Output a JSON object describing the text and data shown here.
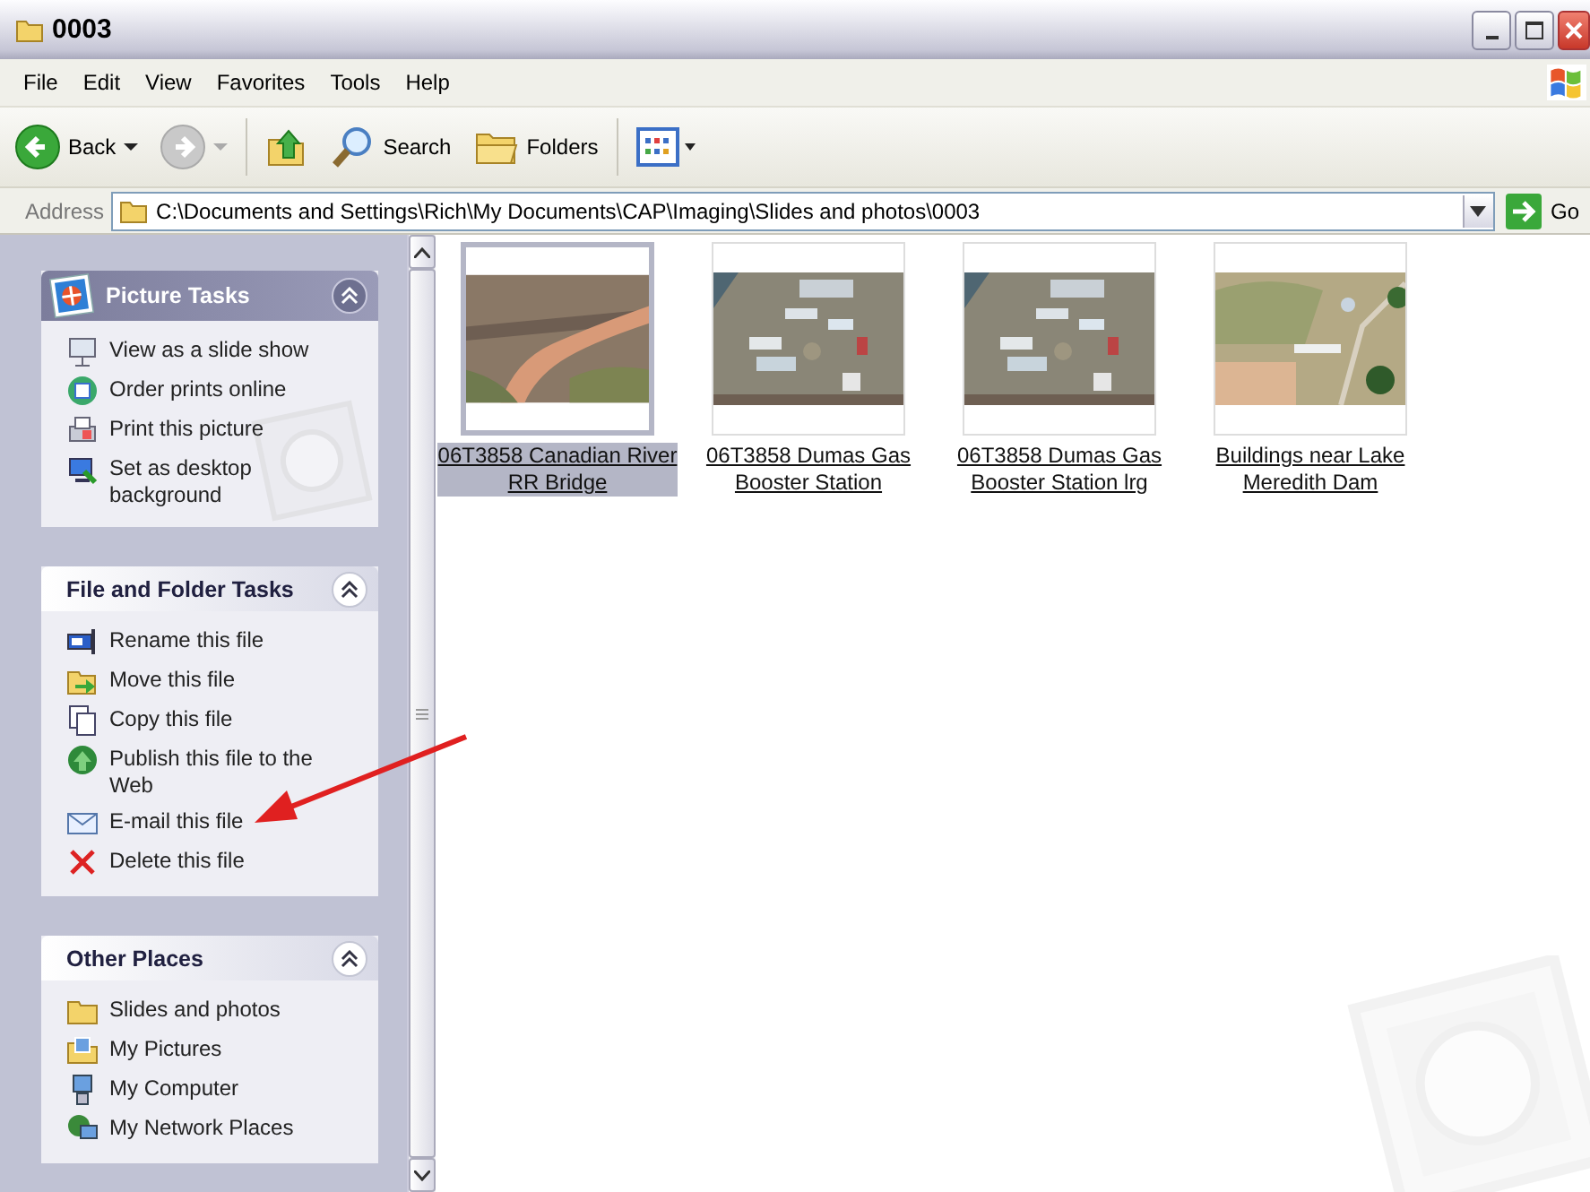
{
  "window": {
    "title": "0003"
  },
  "menu": [
    "File",
    "Edit",
    "View",
    "Favorites",
    "Tools",
    "Help"
  ],
  "toolbar": [
    {
      "kind": "back",
      "label": "Back",
      "disabled": false
    },
    {
      "kind": "forward",
      "disabled": true
    },
    {
      "kind": "up"
    },
    {
      "kind": "search",
      "label": "Search"
    },
    {
      "kind": "folders",
      "label": "Folders"
    },
    {
      "kind": "views"
    }
  ],
  "address": {
    "label": "Address",
    "value": "C:\\Documents and Settings\\Rich\\My Documents\\CAP\\Imaging\\Slides and photos\\0003",
    "go": "Go"
  },
  "panels": [
    {
      "title": "Picture Tasks",
      "kind": "special",
      "expanded": true,
      "items": [
        {
          "kind": "slideshow",
          "label": "View as a slide show"
        },
        {
          "kind": "order",
          "label": "Order prints online"
        },
        {
          "kind": "print",
          "label": "Print this picture"
        },
        {
          "kind": "desktop",
          "label": "Set as desktop background"
        }
      ]
    },
    {
      "title": "File and Folder Tasks",
      "kind": "normal",
      "expanded": true,
      "items": [
        {
          "kind": "rename",
          "label": "Rename this file"
        },
        {
          "kind": "move",
          "label": "Move this file"
        },
        {
          "kind": "copy",
          "label": "Copy this file"
        },
        {
          "kind": "publish",
          "label": "Publish this file to the Web"
        },
        {
          "kind": "email",
          "label": "E-mail this file"
        },
        {
          "kind": "delete",
          "label": "Delete this file"
        }
      ]
    },
    {
      "title": "Other Places",
      "kind": "normal",
      "expanded": true,
      "items": [
        {
          "kind": "folder",
          "label": "Slides and photos"
        },
        {
          "kind": "pictures",
          "label": "My Pictures"
        },
        {
          "kind": "computer",
          "label": "My Computer"
        },
        {
          "kind": "network",
          "label": "My Network Places"
        }
      ]
    }
  ],
  "files": [
    {
      "name": "06T3858 Canadian River RR Bridge",
      "selected": true
    },
    {
      "name": "06T3858 Dumas Gas Booster Station",
      "selected": false
    },
    {
      "name": "06T3858 Dumas Gas Booster Station lrg",
      "selected": false
    },
    {
      "name": "Buildings near Lake Meredith Dam",
      "selected": false
    }
  ]
}
